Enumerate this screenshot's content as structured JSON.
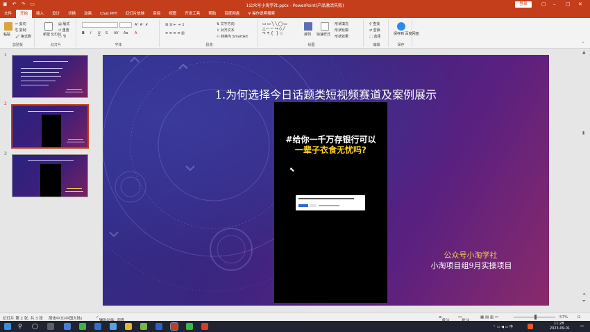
{
  "titlebar": {
    "filename": "1公众号小淘学社.pptx",
    "app": "PowerPoint(产品激活失败)",
    "login": "登录",
    "accent": "#c43e1c"
  },
  "tabs": [
    "文件",
    "开始",
    "插入",
    "设计",
    "切换",
    "动画",
    "Chat PPT",
    "幻灯片放映",
    "审阅",
    "视图",
    "开发工具",
    "帮助",
    "百度网盘"
  ],
  "active_tab": "开始",
  "search_label": "操作说明搜索",
  "ribbon": {
    "clipboard": {
      "paste": "粘贴",
      "cut": "剪切",
      "copy": "复制",
      "format_painter": "格式刷",
      "label": "剪贴板"
    },
    "slides": {
      "new_slide": "新建\n幻灯片",
      "layout": "版式",
      "reset": "重置",
      "section": "节",
      "label": "幻灯片"
    },
    "font": {
      "label": "字体"
    },
    "paragraph": {
      "text_direction": "文字方向",
      "align_text": "对齐文本",
      "smartart": "转换为 SmartArt",
      "label": "段落"
    },
    "drawing": {
      "arrange": "排列",
      "quick_styles": "快速样式",
      "shape_fill": "形状填充",
      "shape_outline": "形状轮廓",
      "shape_effects": "形状效果",
      "label": "绘图"
    },
    "editing": {
      "find": "查找",
      "replace": "替换",
      "select": "选择",
      "label": "编辑"
    },
    "save": {
      "btn": "保存到\n百度网盘",
      "label": "保存"
    }
  },
  "slides": [
    {
      "num": "1"
    },
    {
      "num": "2"
    },
    {
      "num": "3"
    }
  ],
  "main_slide": {
    "title": "1.为何选择今日话题类短视频赛道及案例展示",
    "video_line1": "#给你一千万存银行可以",
    "video_line2": "一辈子衣食无忧吗?",
    "brand_line1": "公众号小淘学社",
    "brand_line2": "小淘项目组9月实操项目"
  },
  "statusbar": {
    "slide_info": "幻灯片 第 2 张, 共 3 张",
    "language": "简体中文(中国大陆)",
    "accessibility": "辅助功能: 调查",
    "notes": "备注",
    "comments": "批注",
    "zoom": "57%"
  },
  "taskbar": {
    "time": "11:28",
    "date": "2023-09-01"
  }
}
